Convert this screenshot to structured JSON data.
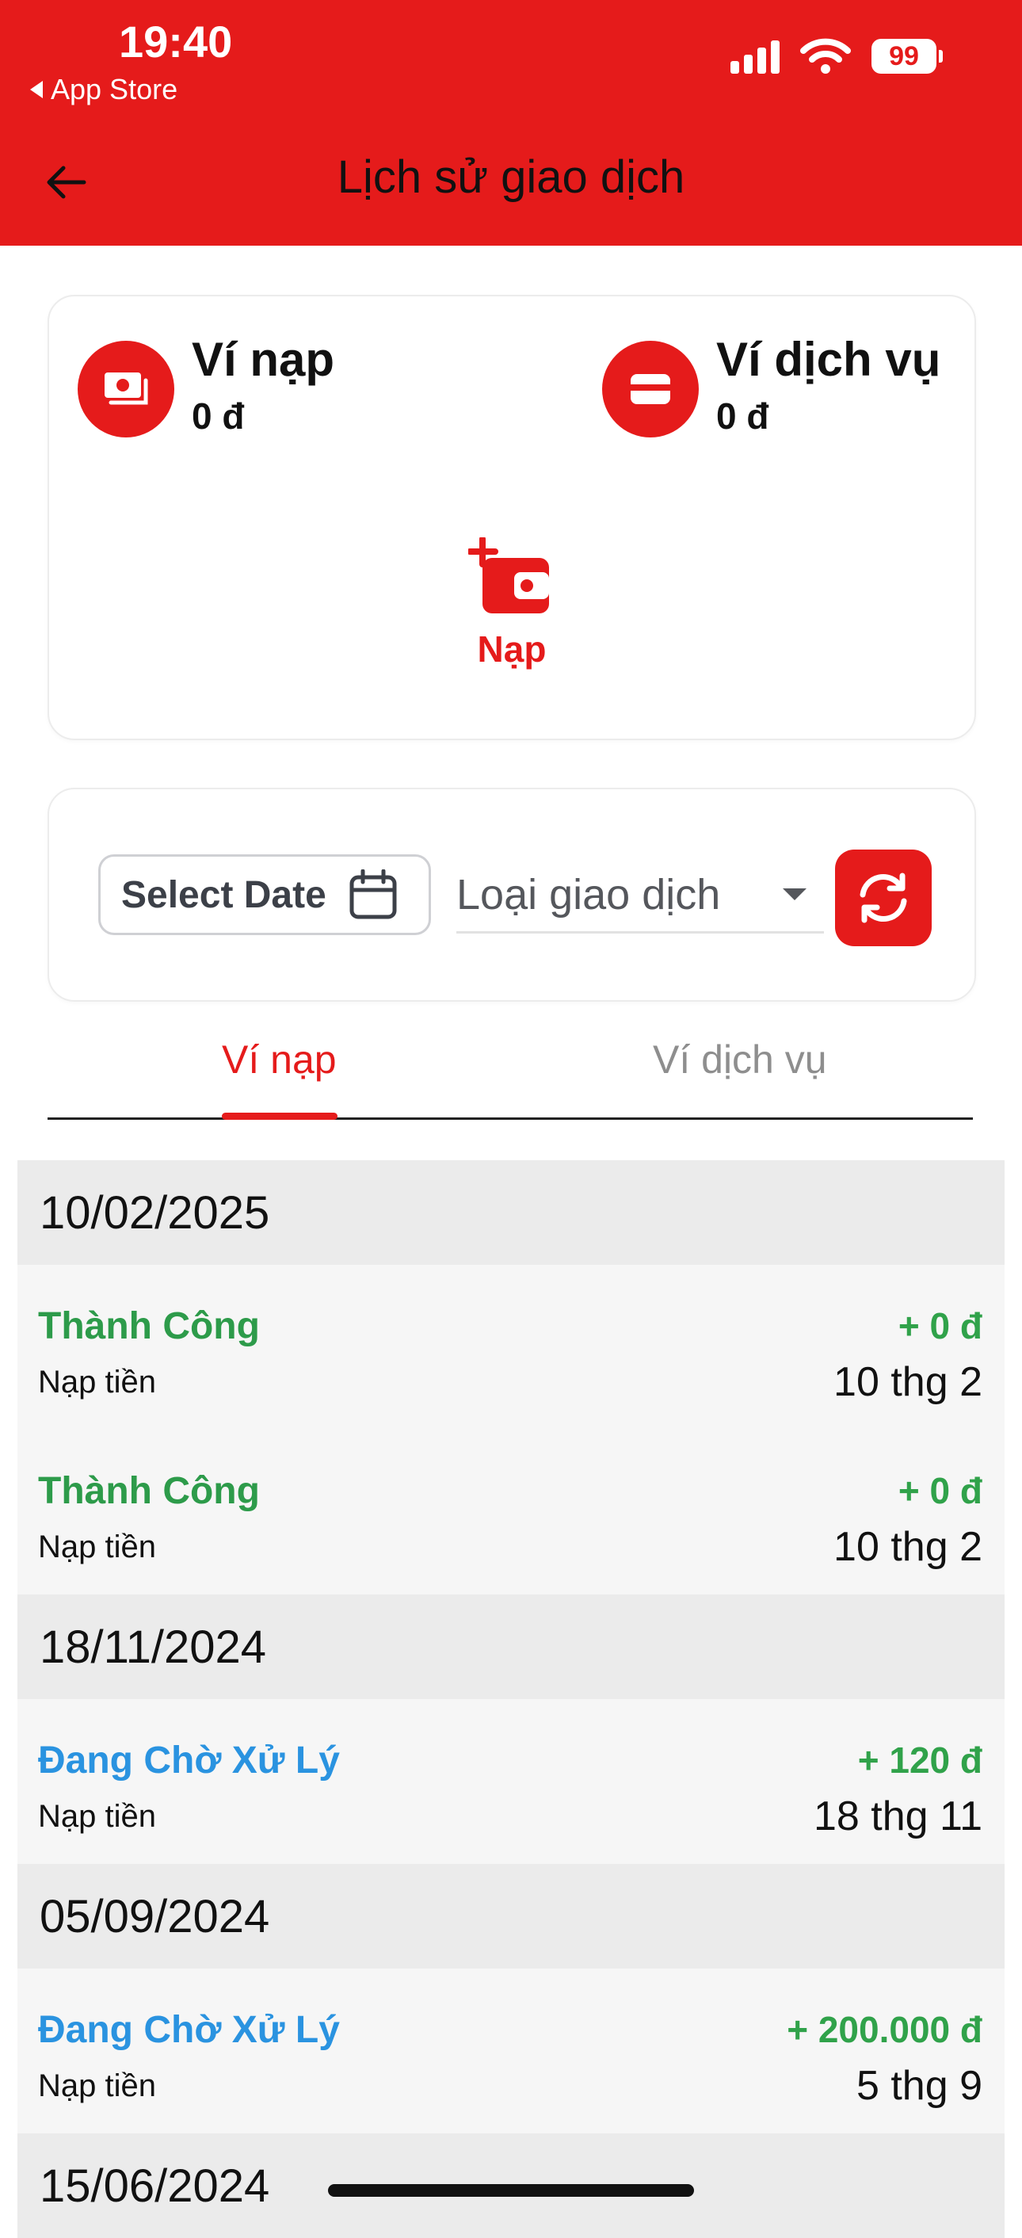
{
  "status_bar": {
    "time": "19:40",
    "back_app": "App Store",
    "battery": "99"
  },
  "header": {
    "title": "Lịch sử giao dịch"
  },
  "wallets": [
    {
      "name": "Ví nạp",
      "amount": "0 đ",
      "icon": "money-icon"
    },
    {
      "name": "Ví dịch vụ",
      "amount": "0 đ",
      "icon": "card-icon"
    }
  ],
  "topup": {
    "label": "Nạp",
    "icon": "add-wallet-icon"
  },
  "filters": {
    "date_label": "Select Date",
    "type_label": "Loại giao dịch"
  },
  "tabs": [
    {
      "label": "Ví nạp",
      "active": true
    },
    {
      "label": "Ví dịch vụ",
      "active": false
    }
  ],
  "groups": [
    {
      "date": "10/02/2025",
      "items": [
        {
          "status": "Thành Công",
          "desc": "Nạp tiền",
          "amount": "+ 0 đ",
          "date": "10 thg 2"
        },
        {
          "status": "Thành Công",
          "desc": "Nạp tiền",
          "amount": "+ 0 đ",
          "date": "10 thg 2"
        }
      ]
    },
    {
      "date": "18/11/2024",
      "items": [
        {
          "status": "Đang Chờ Xử Lý",
          "desc": "Nạp tiền",
          "amount": "+ 120 đ",
          "date": "18 thg 11"
        }
      ]
    },
    {
      "date": "05/09/2024",
      "items": [
        {
          "status": "Đang Chờ Xử Lý",
          "desc": "Nạp tiền",
          "amount": "+ 200.000 đ",
          "date": "5 thg 9"
        }
      ]
    },
    {
      "date": "15/06/2024",
      "items": []
    }
  ],
  "colors": {
    "brand": "#E51B1B",
    "success": "#2d9b4a",
    "pending": "#2a93e0",
    "amount": "#30a24a"
  }
}
